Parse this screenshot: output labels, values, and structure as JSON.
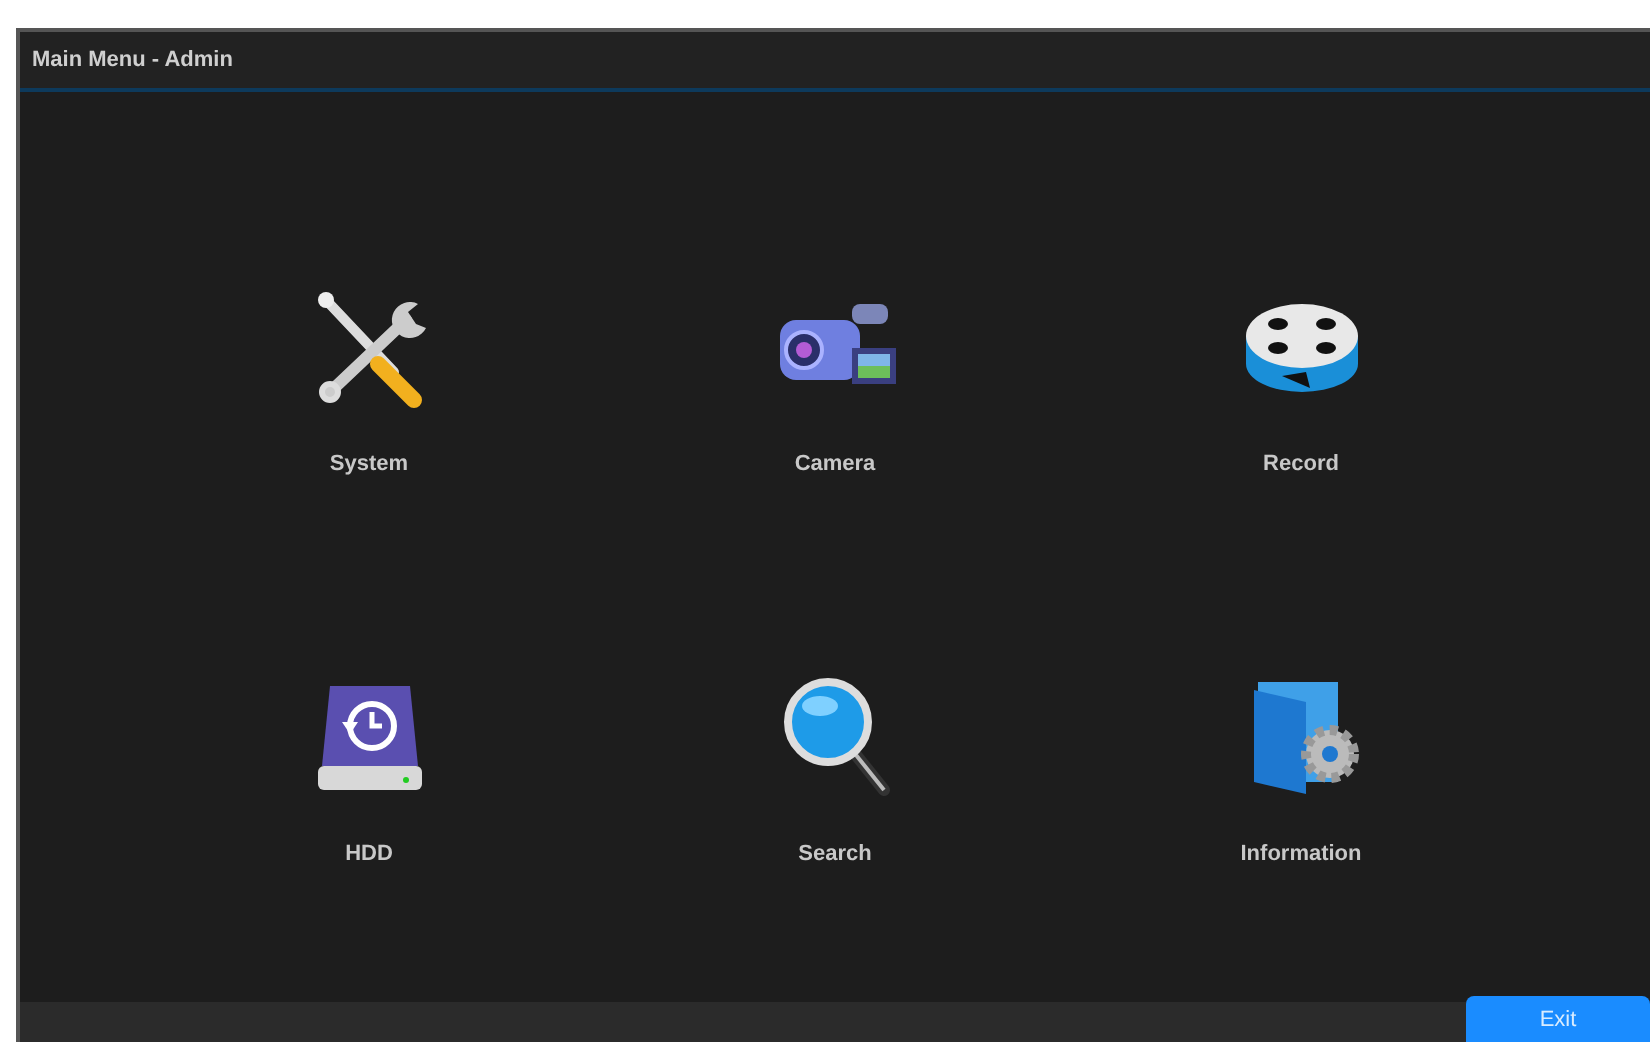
{
  "window": {
    "title": "Main Menu - Admin"
  },
  "menu_items": [
    {
      "kind": "tools",
      "label": "System"
    },
    {
      "kind": "camera",
      "label": "Camera"
    },
    {
      "kind": "reel",
      "label": "Record"
    },
    {
      "kind": "drive",
      "label": "HDD"
    },
    {
      "kind": "magnifier",
      "label": "Search"
    },
    {
      "kind": "folder",
      "label": "Information"
    }
  ],
  "buttons": [
    {
      "label": "Exit"
    }
  ]
}
